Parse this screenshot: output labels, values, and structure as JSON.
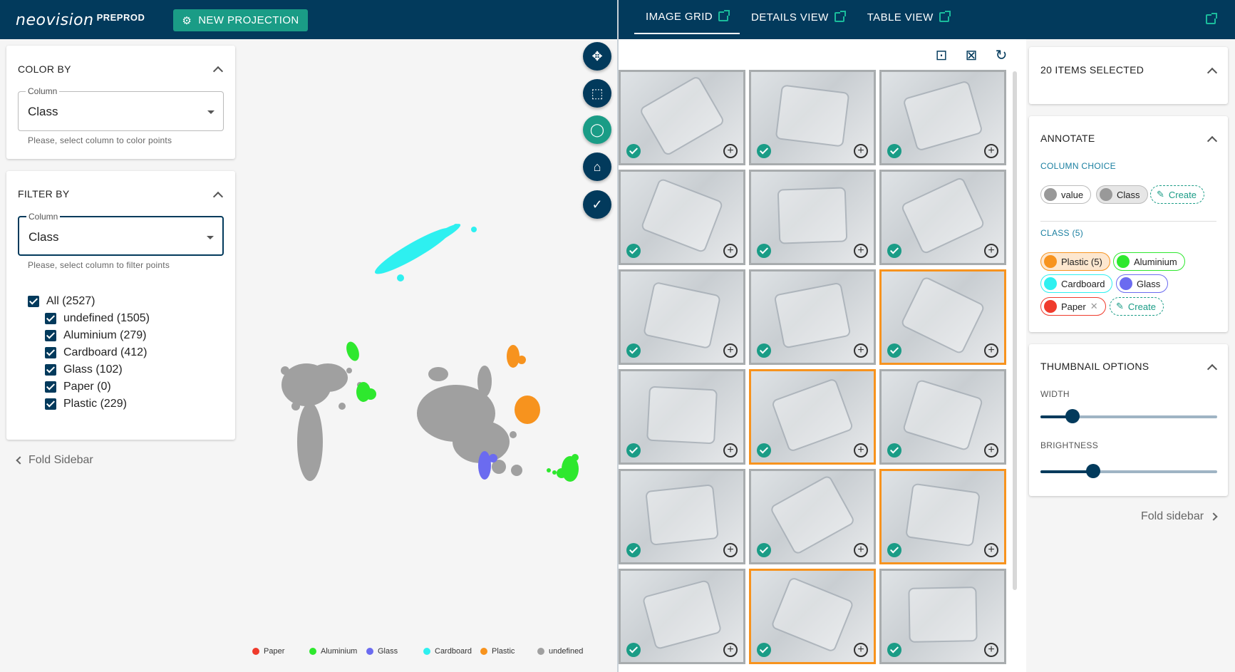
{
  "app": {
    "logo_text": "neovision",
    "env_label": "PREPROD",
    "new_projection_label": "NEW PROJECTION"
  },
  "tabs": [
    {
      "label": "IMAGE GRID",
      "active": true
    },
    {
      "label": "DETAILS VIEW",
      "active": false
    },
    {
      "label": "TABLE VIEW",
      "active": false
    }
  ],
  "color_by": {
    "title": "COLOR BY",
    "column_label": "Column",
    "value": "Class",
    "helper": "Please, select column to color points"
  },
  "filter_by": {
    "title": "FILTER BY",
    "column_label": "Column",
    "value": "Class",
    "helper": "Please, select column to filter points",
    "items": [
      {
        "label": "All (2527)",
        "checked": true
      },
      {
        "label": "undefined (1505)",
        "checked": true
      },
      {
        "label": "Aluminium (279)",
        "checked": true
      },
      {
        "label": "Cardboard (412)",
        "checked": true
      },
      {
        "label": "Glass (102)",
        "checked": true
      },
      {
        "label": "Paper (0)",
        "checked": true
      },
      {
        "label": "Plastic (229)",
        "checked": true
      }
    ]
  },
  "fold_sidebar_left": "Fold Sidebar",
  "map_legend": [
    {
      "label": "Paper",
      "color": "#ef3b2c"
    },
    {
      "label": "Aluminium",
      "color": "#2ee82e"
    },
    {
      "label": "Glass",
      "color": "#6b6bf0"
    },
    {
      "label": "Cardboard",
      "color": "#2ef0f0"
    },
    {
      "label": "Plastic",
      "color": "#f7931e"
    },
    {
      "label": "undefined",
      "color": "#a0a0a0"
    }
  ],
  "colors": {
    "topbar": "#023a5c",
    "accent": "#1a9c86",
    "selected_border": "#f7931e"
  },
  "selection": {
    "title": "20 ITEMS SELECTED"
  },
  "annotate": {
    "title": "ANNOTATE",
    "column_choice_label": "COLUMN CHOICE",
    "column_chips": [
      {
        "label": "value"
      },
      {
        "label": "Class"
      }
    ],
    "create_label": "Create",
    "class_label": "CLASS (5)",
    "class_chips": [
      {
        "label": "Plastic (5)",
        "color": "#f7931e"
      },
      {
        "label": "Aluminium",
        "color": "#2ee82e"
      },
      {
        "label": "Cardboard",
        "color": "#2ef0f0"
      },
      {
        "label": "Glass",
        "color": "#6b6bf0"
      },
      {
        "label": "Paper",
        "color": "#ef3b2c"
      }
    ]
  },
  "thumbnail_options": {
    "title": "THUMBNAIL OPTIONS",
    "width_label": "WIDTH",
    "width_value": 0.18,
    "brightness_label": "BRIGHTNESS",
    "brightness_value": 0.3
  },
  "fold_sidebar_right": "Fold sidebar",
  "grid_selected": [
    false,
    false,
    false,
    false,
    false,
    false,
    false,
    false,
    true,
    false,
    true,
    false,
    false,
    false,
    true,
    false,
    true,
    false
  ]
}
